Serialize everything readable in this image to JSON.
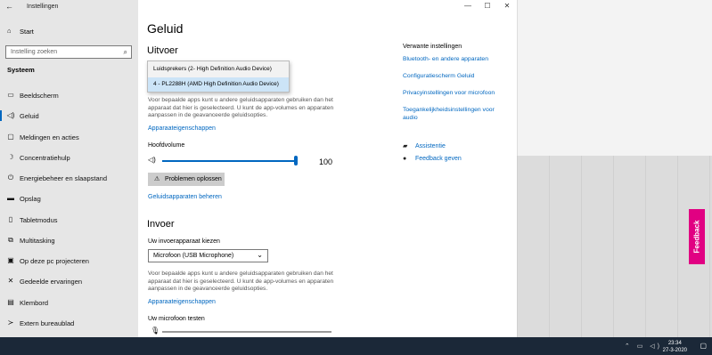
{
  "window": {
    "app_title": "Instellingen",
    "back_icon": "←",
    "controls": [
      "—",
      "☐",
      "✕"
    ]
  },
  "sidebar": {
    "home_label": "Start",
    "search_placeholder": "Instelling zoeken",
    "section_title": "Systeem",
    "items": [
      {
        "label": "Beeldscherm",
        "icon": "monitor-icon",
        "glyph": "▭"
      },
      {
        "label": "Geluid",
        "icon": "speaker-icon",
        "glyph": "🔊",
        "active": true
      },
      {
        "label": "Meldingen en acties",
        "icon": "notification-icon",
        "glyph": "▢"
      },
      {
        "label": "Concentratiehulp",
        "icon": "moon-icon",
        "glyph": "☽"
      },
      {
        "label": "Energiebeheer en slaapstand",
        "icon": "power-icon",
        "glyph": "⏻"
      },
      {
        "label": "Opslag",
        "icon": "storage-icon",
        "glyph": "▬"
      },
      {
        "label": "Tabletmodus",
        "icon": "tablet-icon",
        "glyph": "▯"
      },
      {
        "label": "Multitasking",
        "icon": "multitasking-icon",
        "glyph": "⧉"
      },
      {
        "label": "Op deze pc projecteren",
        "icon": "project-icon",
        "glyph": "▣"
      },
      {
        "label": "Gedeelde ervaringen",
        "icon": "shared-icon",
        "glyph": "✕"
      },
      {
        "label": "Klembord",
        "icon": "clipboard-icon",
        "glyph": "▤"
      },
      {
        "label": "Extern bureaublad",
        "icon": "remote-icon",
        "glyph": "≻"
      }
    ]
  },
  "main": {
    "title": "Geluid",
    "output": {
      "heading": "Uitvoer",
      "dropdown_options": [
        "Luidsprekers (2- High Definition Audio Device)",
        "4 - PL2288H (AMD High Definition Audio Device)"
      ],
      "description": "Voor bepaalde apps kunt u andere geluidsapparaten gebruiken dan het apparaat dat hier is geselecteerd. U kunt de app-volumes en apparaten aanpassen in de geavanceerde geluidsopties.",
      "properties_link": "Apparaateigenschappen",
      "volume_label": "Hoofdvolume",
      "volume_value": "100",
      "troubleshoot_label": "Problemen oplossen",
      "manage_link": "Geluidsapparaten beheren"
    },
    "input": {
      "heading": "Invoer",
      "choose_label": "Uw invoerapparaat kiezen",
      "selected_device": "Microfoon (USB Microphone)",
      "description": "Voor bepaalde apps kunt u andere geluidsapparaten gebruiken dan het apparaat dat hier is geselecteerd. U kunt de app-volumes en apparaten aanpassen in de geavanceerde geluidsopties.",
      "properties_link": "Apparaateigenschappen",
      "test_label": "Uw microfoon testen"
    }
  },
  "related": {
    "title": "Verwante instellingen",
    "links": [
      "Bluetooth- en andere apparaten",
      "Configuratiescherm Geluid",
      "Privacyinstellingen voor microfoon",
      "Toegankelijkheidsinstellingen voor audio"
    ],
    "help": [
      {
        "label": "Assistentie",
        "icon": "help-icon",
        "glyph": "💬"
      },
      {
        "label": "Feedback geven",
        "icon": "feedback-person-icon",
        "glyph": "👤"
      }
    ]
  },
  "feedback_tab": "Feedback",
  "taskbar": {
    "time": "23:34",
    "date": "27-3-2020"
  },
  "colors": {
    "accent": "#0067c0",
    "feedback": "#e10082",
    "taskbar": "#1b2838"
  }
}
